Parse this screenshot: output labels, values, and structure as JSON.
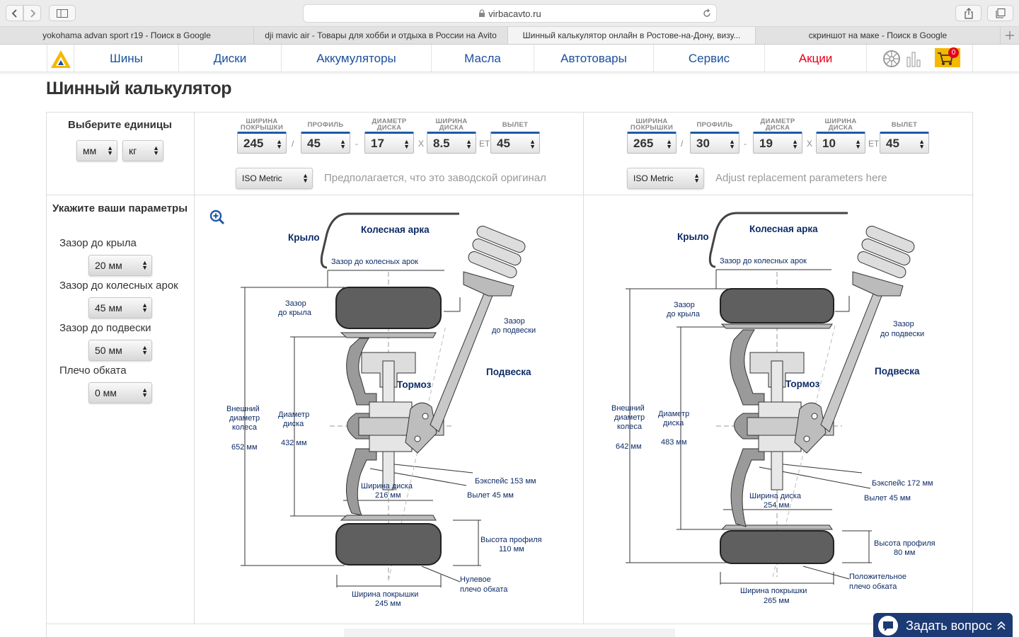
{
  "browser": {
    "url": "virbacavto.ru",
    "tabs": [
      {
        "label": "yokohama advan sport r19 - Поиск в Google"
      },
      {
        "label": "dji mavic air - Товары для хобби и отдыха в России на Avito"
      },
      {
        "label": "Шинный калькулятор онлайн в Ростове-на-Дону, визу..."
      },
      {
        "label": "скриншот на маке - Поиск в Google"
      }
    ]
  },
  "nav": {
    "items": [
      "Шины",
      "Диски",
      "Аккумуляторы",
      "Масла",
      "Автотовары",
      "Сервис",
      "Акции"
    ],
    "cart_count": "0",
    "promo_color": "#e3001b",
    "link_color": "#1b4f9c"
  },
  "page_title": "Шинный калькулятор",
  "units": {
    "heading": "Выберите единицы",
    "length": "мм",
    "weight": "кг"
  },
  "params": {
    "heading": "Укажите ваши параметры",
    "items": [
      {
        "label": "Зазор до крыла",
        "value": "20 мм"
      },
      {
        "label": "Зазор до колесных арок",
        "value": "45 мм"
      },
      {
        "label": "Зазор до подвески",
        "value": "50 мм"
      },
      {
        "label": "Плечо обката",
        "value": "0 мм"
      }
    ]
  },
  "captions": {
    "tire_width": "ШИРИНА ПОКРЫШКИ",
    "profile": "ПРОФИЛЬ",
    "rim_diam": "ДИАМЕТР ДИСКА",
    "rim_width": "ШИРИНА ДИСКА",
    "offset": "ВЫЛЕТ"
  },
  "left": {
    "tire_width": "245",
    "profile": "45",
    "rim_diam": "17",
    "rim_width": "8.5",
    "offset": "45",
    "standard": "ISO Metric",
    "hint": "Предполагается, что это заводской оригинал",
    "diagram": {
      "krylo": "Крыло",
      "arka": "Колесная арка",
      "arka_gap": "Зазор до колесных арок",
      "wing_gap_1": "Зазор",
      "wing_gap_2": "до крыла",
      "susp_gap_1": "Зазор",
      "susp_gap_2": "до подвески",
      "podveska": "Подвеска",
      "tormoz": "Тормоз",
      "outer_1": "Внешний",
      "outer_2": "диаметр",
      "outer_3": "колеса",
      "outer_val": "652 мм",
      "rimd_1": "Диаметр",
      "rimd_2": "диска",
      "rimd_val": "432 мм",
      "backspace": "Бэкспейс 153 мм",
      "vylet": "Вылет 45 мм",
      "rimw_1": "Ширина диска",
      "rimw_2": "216 мм",
      "prof_1": "Высота профиля",
      "prof_2": "110 мм",
      "scrub_1": "Нулевое",
      "scrub_2": "плечо обката",
      "tirew_1": "Ширина покрышки",
      "tirew_2": "245 мм"
    }
  },
  "right": {
    "tire_width": "265",
    "profile": "30",
    "rim_diam": "19",
    "rim_width": "10",
    "offset": "45",
    "standard": "ISO Metric",
    "hint": "Adjust replacement parameters here",
    "diagram": {
      "krylo": "Крыло",
      "arka": "Колесная арка",
      "arka_gap": "Зазор до колесных арок",
      "wing_gap_1": "Зазор",
      "wing_gap_2": "до крыла",
      "susp_gap_1": "Зазор",
      "susp_gap_2": "до подвески",
      "podveska": "Подвеска",
      "tormoz": "Тормоз",
      "outer_1": "Внешний",
      "outer_2": "диаметр",
      "outer_3": "колеса",
      "outer_val": "642 мм",
      "rimd_1": "Диаметр",
      "rimd_2": "диска",
      "rimd_val": "483 мм",
      "backspace": "Бэкспейс 172 мм",
      "vylet": "Вылет 45 мм",
      "rimw_1": "Ширина диска",
      "rimw_2": "254 мм",
      "prof_1": "Высота профиля",
      "prof_2": "80 мм",
      "scrub_1": "Положительное",
      "scrub_2": "плечо обката",
      "tirew_1": "Ширина покрышки",
      "tirew_2": "265 мм"
    }
  },
  "separators": {
    "slash": "/",
    "dash": "-",
    "x": "X",
    "et": "ET"
  },
  "chat": {
    "label": "Задать вопрос"
  }
}
